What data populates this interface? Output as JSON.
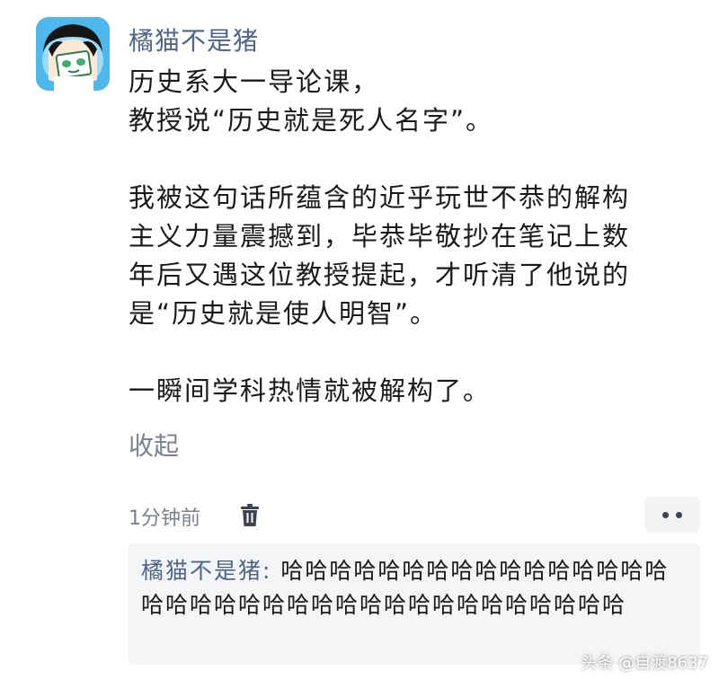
{
  "comment": {
    "username": "橘猫不是猪",
    "lines": [
      "历史系大一导论课，",
      "教授说“历史就是死人名字”。",
      "",
      "我被这句话所蕴含的近乎玩世不恭的解构",
      "主义力量震撼到，毕恭毕敬抄在笔记上数",
      "年后又遇这位教授提起，才听清了他说的",
      "是“历史就是使人明智”。",
      "",
      "一瞬间学科热情就被解构了。"
    ],
    "collapse_label": "收起",
    "timestamp": "1分钟前",
    "icons": {
      "delete": "trash-icon",
      "more": "more-dots-icon"
    }
  },
  "reply": {
    "author": "橘猫不是猪:",
    "text": "哈哈哈哈哈哈哈哈哈哈哈哈哈哈哈哈哈哈哈哈哈哈哈哈哈哈哈哈哈哈哈哈哈哈哈哈"
  },
  "watermark": "头条 @自渡8637",
  "colors": {
    "username": "#4f6587",
    "secondary_text": "#7b8190",
    "reply_background": "#f4f5f7",
    "avatar_background": "#5fc4f0"
  }
}
